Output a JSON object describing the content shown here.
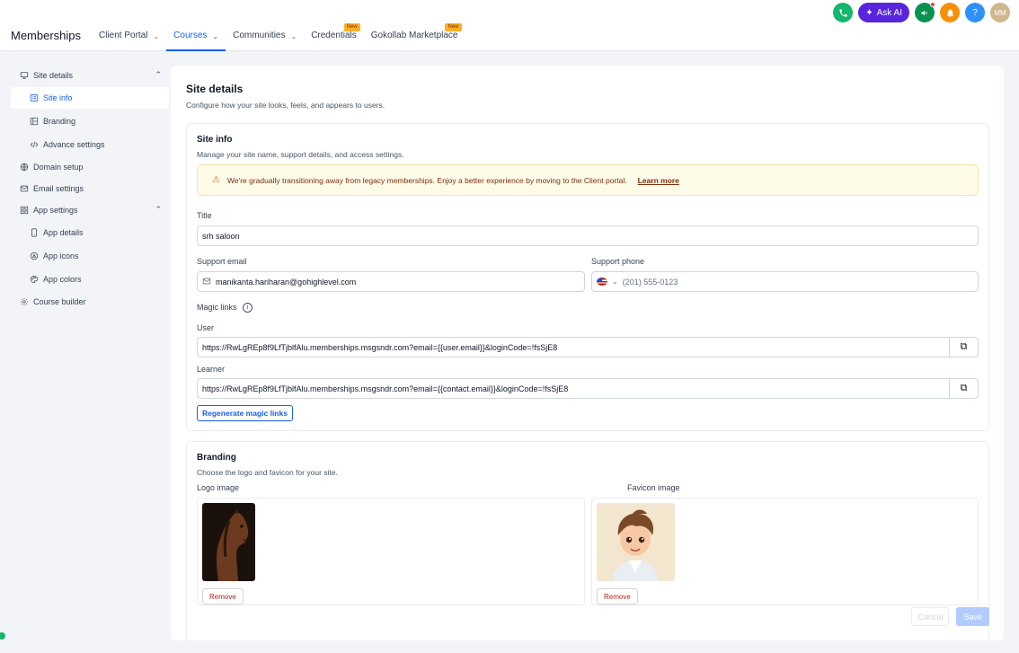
{
  "app": {
    "title": "Memberships"
  },
  "nav": [
    {
      "label": "Client Portal",
      "chevron": true,
      "active": false,
      "badge": ""
    },
    {
      "label": "Courses",
      "chevron": true,
      "active": true,
      "badge": ""
    },
    {
      "label": "Communities",
      "chevron": true,
      "active": false,
      "badge": ""
    },
    {
      "label": "Credentials",
      "chevron": false,
      "active": false,
      "badge": "New"
    },
    {
      "label": "Gokollab Marketplace",
      "chevron": false,
      "active": false,
      "badge": "New"
    }
  ],
  "top_actions": {
    "ask_ai": "Ask AI",
    "avatar": "MM",
    "help": "?"
  },
  "sidebar": {
    "site_details": "Site details",
    "site_info": "Site info",
    "branding": "Branding",
    "advance_settings": "Advance settings",
    "domain_setup": "Domain setup",
    "email_settings": "Email settings",
    "app_settings": "App settings",
    "app_details": "App details",
    "app_icons": "App icons",
    "app_colors": "App colors",
    "course_builder": "Course builder"
  },
  "page": {
    "title": "Site details",
    "subtitle": "Configure how your site looks, feels, and appears to users."
  },
  "site_info": {
    "title": "Site info",
    "subtitle": "Manage your site name, support details, and access settings.",
    "alert_text": "We're gradually transitioning away from legacy memberships. Enjoy a better experience by moving to the Client portal.",
    "alert_link": "Learn more",
    "title_label": "Title",
    "title_value": "srh saloon",
    "support_email_label": "Support email",
    "support_email_value": "manikanta.hariharan@gohighlevel.com",
    "support_phone_label": "Support phone",
    "support_phone_placeholder": "(201) 555-0123",
    "magic_links_label": "Magic links",
    "user_label": "User",
    "user_link": "https://RwLgREp8f9LfTjblfAlu.memberships.msgsndr.com?email={{user.email}}&loginCode=!fsSjE8",
    "learner_label": "Learner",
    "learner_link": "https://RwLgREp8f9LfTjblfAlu.memberships.msgsndr.com?email={{contact.email}}&loginCode=!fsSjE8",
    "regenerate_label": "Regenerate magic links"
  },
  "branding": {
    "title": "Branding",
    "subtitle": "Choose the logo and favicon for your site.",
    "logo_label": "Logo image",
    "favicon_label": "Favicon image",
    "remove_label": "Remove"
  },
  "footer": {
    "cancel": "Cancel",
    "save": "Save"
  }
}
